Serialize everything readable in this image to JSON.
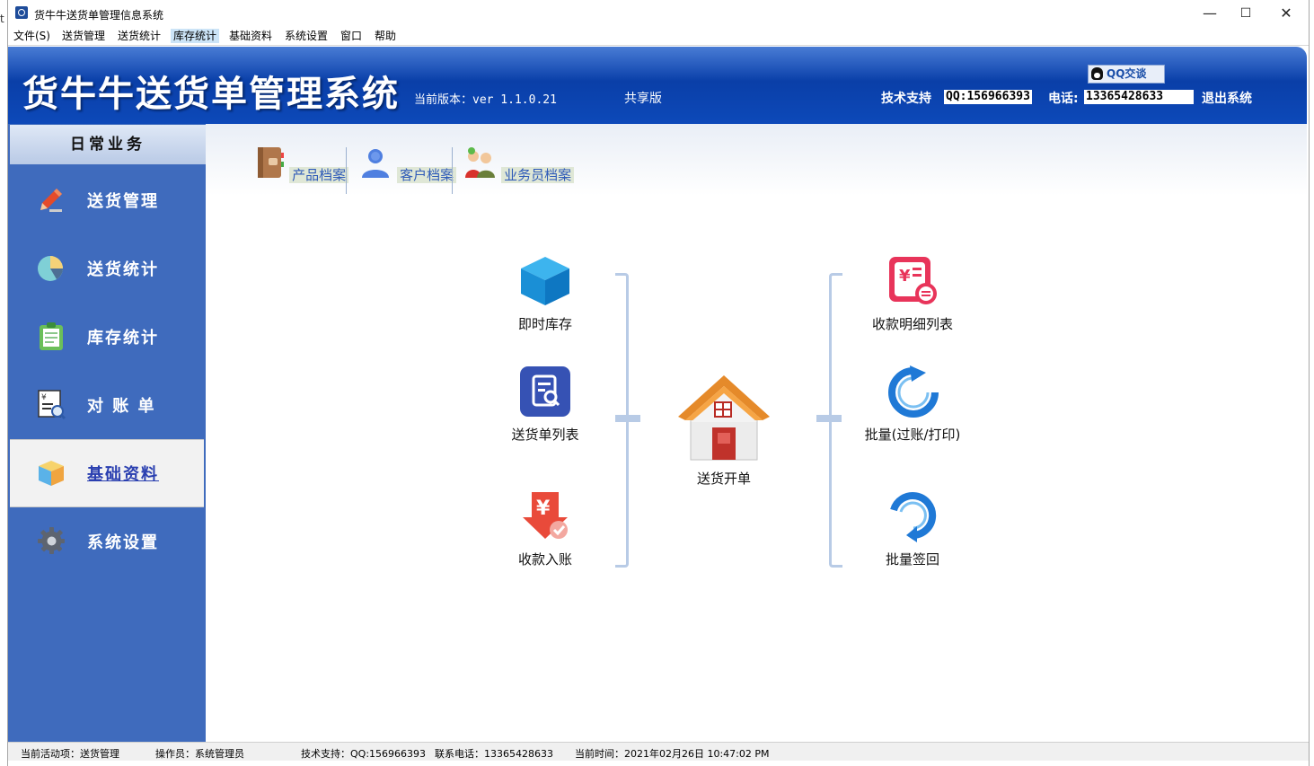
{
  "titlebar": {
    "title": "货牛牛送货单管理信息系统",
    "minimize": "—",
    "maximize": "☐",
    "close": "✕"
  },
  "menubar": [
    {
      "label": "文件(S)"
    },
    {
      "label": "送货管理"
    },
    {
      "label": "送货统计"
    },
    {
      "label": "库存统计",
      "active": true
    },
    {
      "label": "基础资料"
    },
    {
      "label": "系统设置"
    },
    {
      "label": "窗口"
    },
    {
      "label": "帮助"
    }
  ],
  "banner": {
    "title": "货牛牛送货单管理系统",
    "version": "当前版本：ver 1.1.0.21",
    "edition": "共享版",
    "qq_badge": "QQ交谈",
    "support_label": "技术支持",
    "qq_number": "QQ:156966393",
    "phone_label": "电话:",
    "phone_number": "13365428633",
    "logout": "退出系统"
  },
  "sidebar": {
    "header": "日常业务",
    "items": [
      {
        "label": "送货管理",
        "icon": "pencil-icon"
      },
      {
        "label": "送货统计",
        "icon": "pie-chart-icon"
      },
      {
        "label": "库存统计",
        "icon": "clipboard-icon"
      },
      {
        "label": "对 账 单",
        "icon": "statement-search-icon"
      },
      {
        "label": "基础资料",
        "icon": "cube-icon",
        "active": true
      },
      {
        "label": "系统设置",
        "icon": "gear-icon"
      }
    ]
  },
  "quick": [
    {
      "label": "产品档案",
      "icon": "book-icon"
    },
    {
      "label": "客户档案",
      "icon": "user-icon"
    },
    {
      "label": "业务员档案",
      "icon": "salesperson-icon"
    }
  ],
  "functions": {
    "left": [
      {
        "label": "即时库存",
        "icon": "cube-icon"
      },
      {
        "label": "送货单列表",
        "icon": "document-search-icon"
      },
      {
        "label": "收款入账",
        "icon": "yen-receive-icon"
      }
    ],
    "center": {
      "label": "送货开单",
      "icon": "house-icon"
    },
    "right": [
      {
        "label": "收款明细列表",
        "icon": "receipt-exchange-icon"
      },
      {
        "label": "批量(过账/打印)",
        "icon": "refresh-arrow-icon"
      },
      {
        "label": "批量签回",
        "icon": "return-arrow-icon"
      }
    ]
  },
  "statusbar": {
    "activity": "当前活动项：送货管理",
    "operator": "操作员：系统管理员",
    "support": "技术支持：QQ:156966393",
    "phone": "联系电话：13365428633",
    "time": "当前时间：2021年02月26日 10:47:02 PM"
  },
  "colors": {
    "banner": "#0a3fa8",
    "sidebar": "#3f6bbd",
    "accent": "#2f5bb8"
  }
}
